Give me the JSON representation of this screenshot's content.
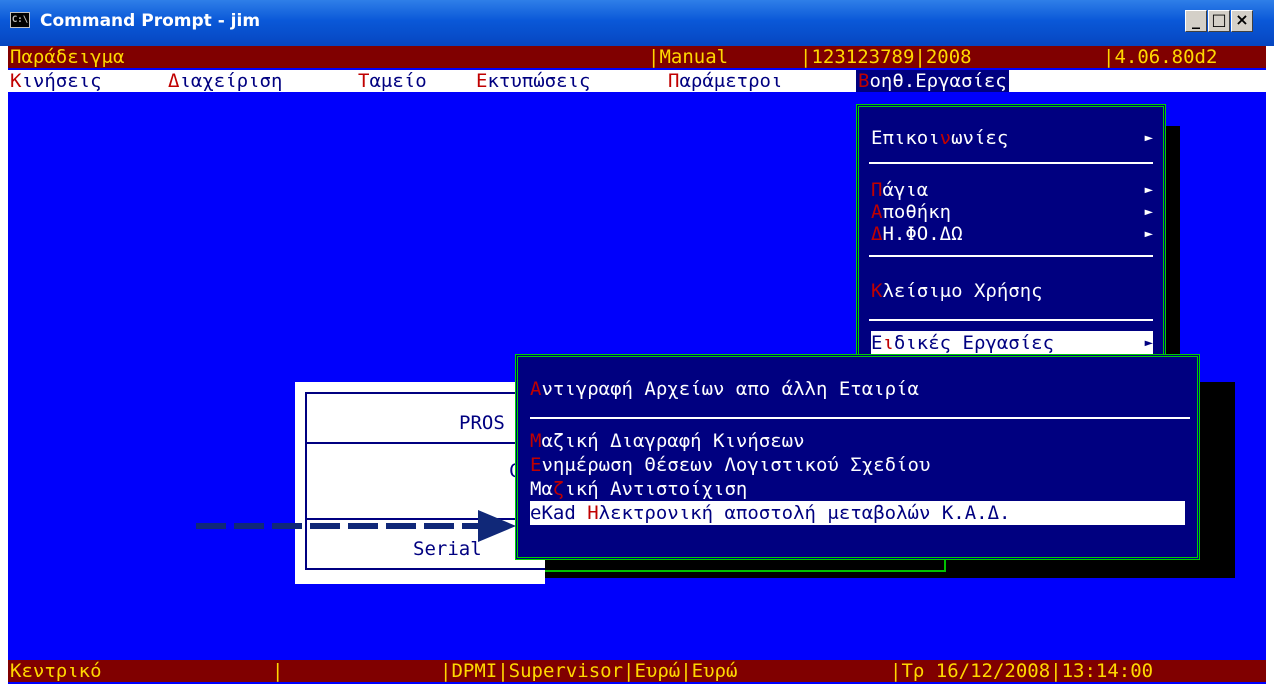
{
  "window": {
    "title": "Command Prompt - jim",
    "icon": "C:\\",
    "buttons": {
      "minimize": "_",
      "maximize": "□",
      "close": "×"
    }
  },
  "status_top": {
    "company": "Παράδειγμα",
    "mode": "|Manual",
    "code": "|123123789|2008",
    "version": "|4.06.80d2"
  },
  "menubar": {
    "items": [
      {
        "hotkey": "Κ",
        "rest": "ινήσεις"
      },
      {
        "hotkey": "Δ",
        "rest": "ιαχείριση"
      },
      {
        "hotkey": "Τ",
        "rest": "αμείο"
      },
      {
        "hotkey": "Ε",
        "rest": "κτυπώσεις"
      },
      {
        "hotkey": "Π",
        "rest": "αράμετροι"
      },
      {
        "hotkey": "Β",
        "rest": "οηθ.Εργασίες"
      }
    ]
  },
  "dropdown": {
    "items": [
      {
        "pre": "Επικοι",
        "hotkey": "ν",
        "rest": "ωνίες",
        "arrow": "►"
      },
      {
        "pre": "",
        "hotkey": "Π",
        "rest": "άγια",
        "arrow": "►"
      },
      {
        "pre": "",
        "hotkey": "Α",
        "rest": "ποθήκη",
        "arrow": "►"
      },
      {
        "pre": "",
        "hotkey": "Δ",
        "rest": "Η.ΦΟ.ΔΩ",
        "arrow": "►"
      },
      {
        "pre": "",
        "hotkey": "Κ",
        "rest": "λείσιμο Χρήσης",
        "arrow": ""
      },
      {
        "pre": "Ε",
        "hotkey": "ι",
        "rest": "δικές Εργασίες",
        "arrow": "►"
      }
    ]
  },
  "submenu": {
    "items": [
      {
        "hotkey": "Α",
        "rest": "ντιγραφή Αρχείων απο άλλη Εταιρία"
      },
      {
        "hotkey": "Μ",
        "rest": "αζική Διαγραφή Κινήσεων"
      },
      {
        "hotkey": "Ε",
        "rest": "νημέρωση Θέσεων Λογιστικού Σχεδίου"
      },
      {
        "pre": "Μα",
        "hotkey": "ζ",
        "rest": "ική Αντιστοίχιση"
      },
      {
        "pre": "eKad ",
        "hotkey": "Η",
        "rest": "λεκτρονική αποστολή μεταβολών Κ.Α.Δ."
      }
    ]
  },
  "dialog": {
    "line1": "PROS",
    "line2": "C",
    "line3": "Serial"
  },
  "status_bottom": {
    "module": "Κεντρικό",
    "sep": "|",
    "info": "|DPMI|Supervisor|Ευρώ|Ευρώ",
    "datetime": "|Τρ 16/12/2008|13:14:00"
  },
  "colors": {
    "console_bg": "#0000fc",
    "status_bg": "#800000",
    "status_fg": "#ffd800",
    "hotkey": "#c00000",
    "menu_border": "#00d000"
  }
}
